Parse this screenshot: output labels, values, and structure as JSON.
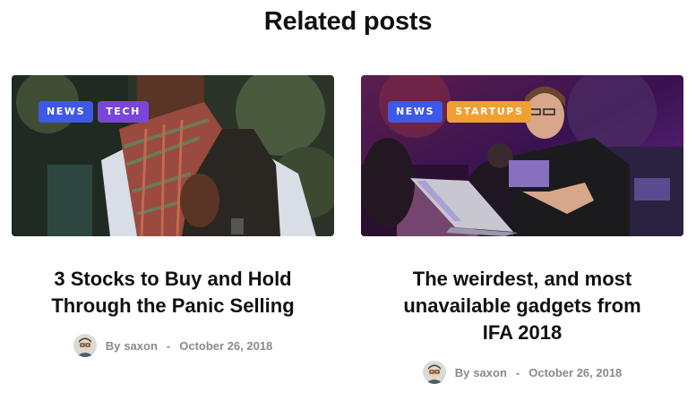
{
  "section": {
    "title": "Related posts"
  },
  "posts": [
    {
      "tags": [
        {
          "label": "NEWS",
          "color": "#3f58e8"
        },
        {
          "label": "TECH",
          "color": "#7a46d8"
        }
      ],
      "title": "3 Stocks to Buy and Hold Through the Panic Selling",
      "by": "By",
      "author": "saxon",
      "separator": "-",
      "date": "October 26, 2018"
    },
    {
      "tags": [
        {
          "label": "NEWS",
          "color": "#3f58e8"
        },
        {
          "label": "STARTUPS",
          "color": "#f0a030"
        }
      ],
      "title": "The weirdest, and most unavailable gadgets from IFA 2018",
      "by": "By",
      "author": "saxon",
      "separator": "-",
      "date": "October 26, 2018"
    }
  ]
}
